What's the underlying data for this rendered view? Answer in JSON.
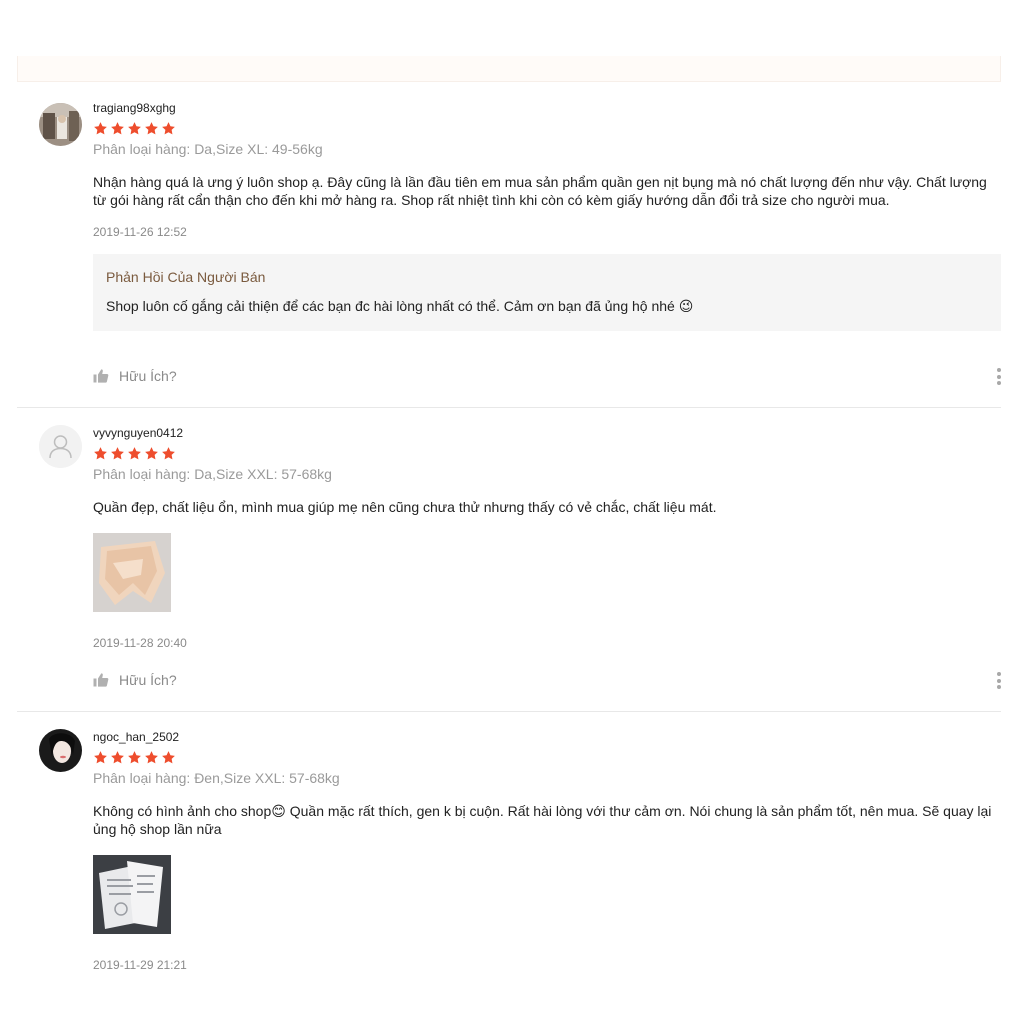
{
  "colors": {
    "star": "#ee4d2d",
    "reply_title": "#7a5a3e",
    "muted": "#8a8a8a"
  },
  "reviews": [
    {
      "username": "tragiang98xghg",
      "rating": 5,
      "variant": "Phân loại hàng: Da,Size XL: 49-56kg",
      "comment": "Nhận hàng quá là ưng ý luôn shop ạ. Đây cũng là lần đầu tiên em mua sản phẩm quần gen nịt bụng mà nó chất lượng đến như vậy. Chất lượng từ gói hàng rất cẩn thận cho đến khi mở hàng ra. Shop rất nhiệt tình khi còn có kèm giấy hướng dẫn đổi trả size cho người mua.",
      "date": "2019-11-26 12:52",
      "seller_reply": {
        "title": "Phản Hồi Của Người Bán",
        "text": "Shop luôn cố gắng cải thiện để các bạn đc hài lòng nhất có thể. Cảm ơn bạn đã ủng hộ nhé 😉"
      },
      "helpful": "Hữu Ích?"
    },
    {
      "username": "vyvynguyen0412",
      "rating": 5,
      "variant": "Phân loại hàng: Da,Size XXL: 57-68kg",
      "comment": "Quần đẹp, chất liệu ổn, mình mua giúp mẹ nên cũng chưa thử nhưng thấy có vẻ chắc, chất liệu mát.",
      "date": "2019-11-28 20:40",
      "helpful": "Hữu Ích?"
    },
    {
      "username": "ngoc_han_2502",
      "rating": 5,
      "variant": "Phân loại hàng: Đen,Size XXL: 57-68kg",
      "comment": "Không có hình ảnh cho shop😊 Quần mặc rất thích, gen k bị cuộn. Rất hài lòng với thư cảm ơn. Nói chung là sản phẩm tốt, nên mua. Sẽ quay lại ủng hộ shop lần nữa",
      "date": "2019-11-29 21:21"
    }
  ]
}
